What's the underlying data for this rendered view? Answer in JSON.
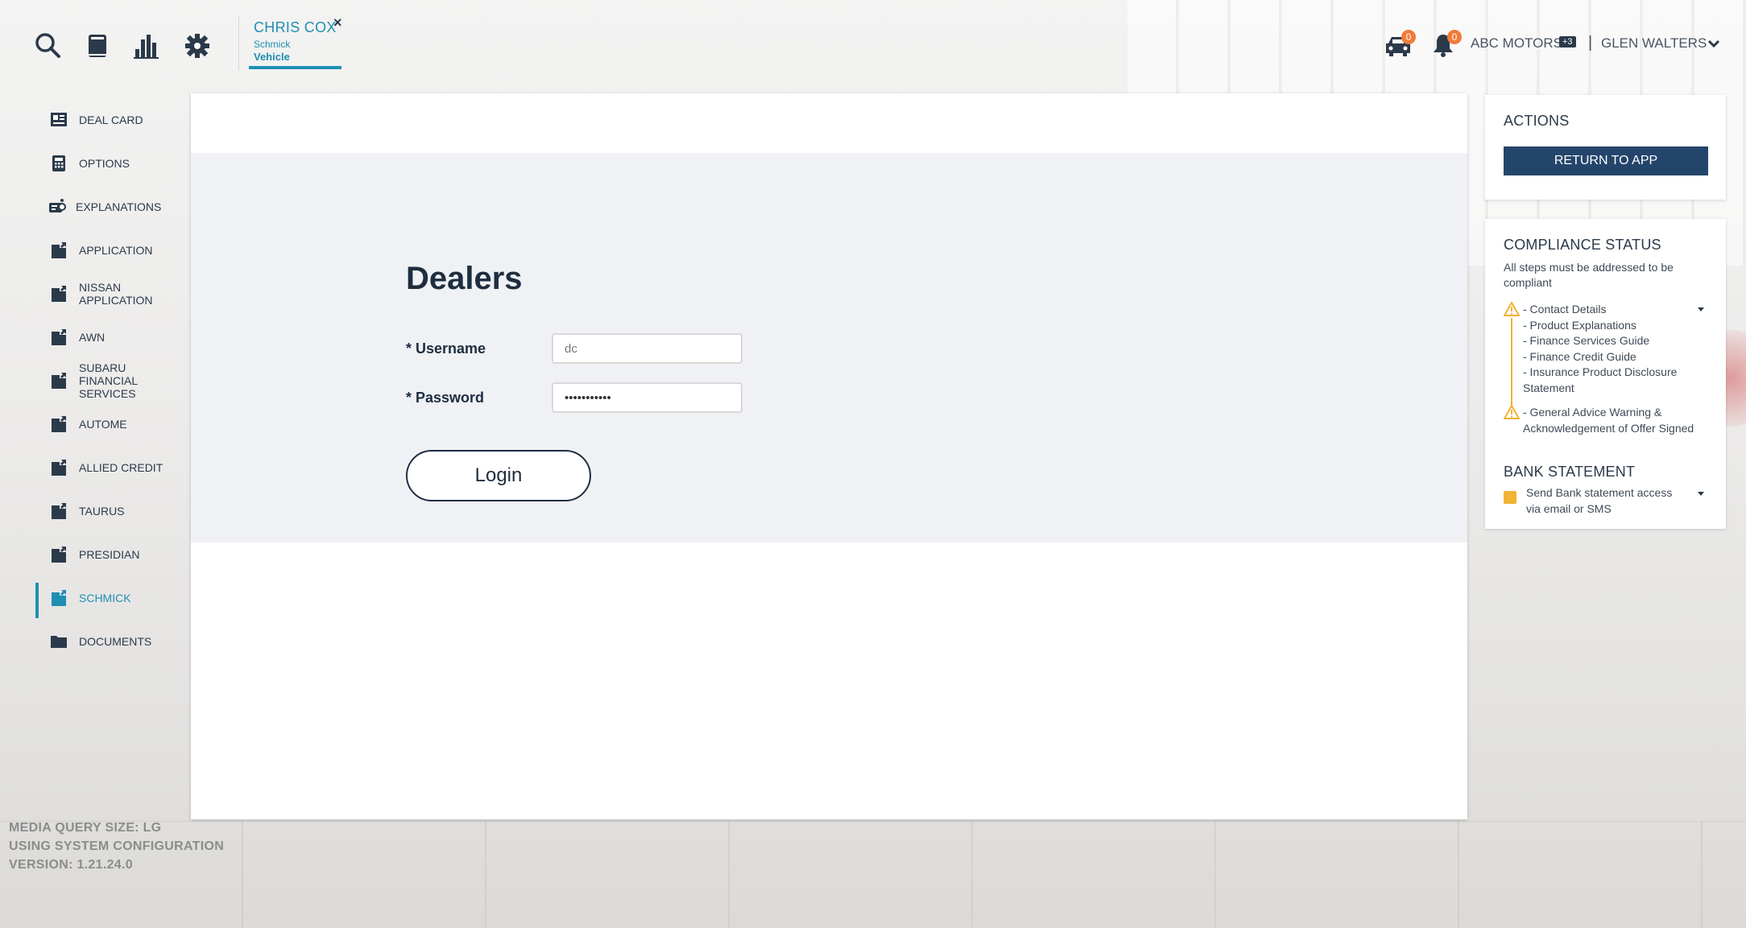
{
  "header": {
    "icons": [
      "search-icon",
      "book-icon",
      "bar-chart-icon",
      "gear-icon"
    ],
    "tab": {
      "name": "CHRIS COX",
      "subtitle": "Schmick",
      "section": "Vehicle",
      "close": "×"
    },
    "car_badge": "0",
    "bell_badge": "0",
    "dealer": "ABC MOTORS",
    "dealer_extra": "+3",
    "separator": "|",
    "user": "GLEN WALTERS"
  },
  "sidebar": {
    "items": [
      {
        "label": "DEAL CARD",
        "icon": "deal-card-icon"
      },
      {
        "label": "OPTIONS",
        "icon": "calculator-icon"
      },
      {
        "label": "EXPLANATIONS",
        "icon": "explanations-icon"
      },
      {
        "label": "APPLICATION",
        "icon": "document-link-icon"
      },
      {
        "label": "NISSAN APPLICATION",
        "icon": "document-link-icon"
      },
      {
        "label": "AWN",
        "icon": "document-link-icon"
      },
      {
        "label": "SUBARU FINANCIAL SERVICES",
        "icon": "document-link-icon"
      },
      {
        "label": "AUTOME",
        "icon": "document-link-icon"
      },
      {
        "label": "ALLIED CREDIT",
        "icon": "document-link-icon"
      },
      {
        "label": "TAURUS",
        "icon": "document-link-icon"
      },
      {
        "label": "PRESIDIAN",
        "icon": "document-link-icon"
      },
      {
        "label": "SCHMICK",
        "icon": "document-link-icon",
        "active": true
      },
      {
        "label": "DOCUMENTS",
        "icon": "folder-icon"
      }
    ]
  },
  "system_info": {
    "line1": "MEDIA QUERY SIZE: LG",
    "line2": "USING SYSTEM CONFIGURATION",
    "line3": "VERSION: 1.21.24.0"
  },
  "login": {
    "title": "Dealers",
    "username_label": "* Username",
    "username_value": "dc",
    "password_label": "* Password",
    "password_value": "•••••••••••",
    "button": "Login"
  },
  "actions": {
    "title": "ACTIONS",
    "return_button": "RETURN TO APP"
  },
  "compliance": {
    "title": "COMPLIANCE STATUS",
    "subtitle": "All steps must be addressed to be compliant",
    "group1": [
      "- Contact Details",
      "- Product Explanations",
      "- Finance Services Guide",
      "- Finance Credit Guide",
      "- Insurance Product Disclosure",
      "Statement"
    ],
    "group2": [
      "- General Advice Warning &",
      "Acknowledgement of Offer Signed"
    ],
    "bank_title": "BANK STATEMENT",
    "bank_line1": "Send Bank statement access",
    "bank_line2": "via email or SMS"
  },
  "colors": {
    "accent": "#1f8fb3",
    "primary_dark": "#24456b",
    "warning": "#f2b233",
    "badge": "#f07c3a"
  }
}
